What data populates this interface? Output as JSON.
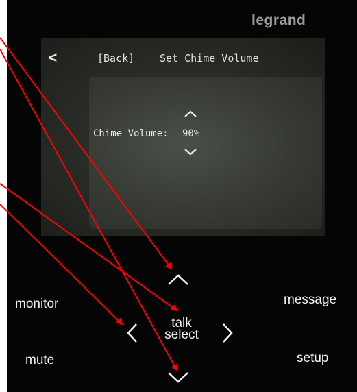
{
  "device": {
    "brand": "legrand"
  },
  "screen": {
    "back_chevron": "<",
    "back_label": "[Back]",
    "title": "Set Chime Volume",
    "setting_label": "Chime Volume:",
    "setting_value": "90%"
  },
  "keypad": {
    "monitor": "monitor",
    "message": "message",
    "mute": "mute",
    "setup": "setup",
    "talk": "talk",
    "select": "select"
  },
  "icons": {
    "up": "chevron-up-icon",
    "down": "chevron-down-icon",
    "left": "chevron-left-icon",
    "right": "chevron-right-icon"
  },
  "colors": {
    "panel": "#050505",
    "lcd_text": "#dfe4dc",
    "annotation_arrow": "#ff0000"
  }
}
